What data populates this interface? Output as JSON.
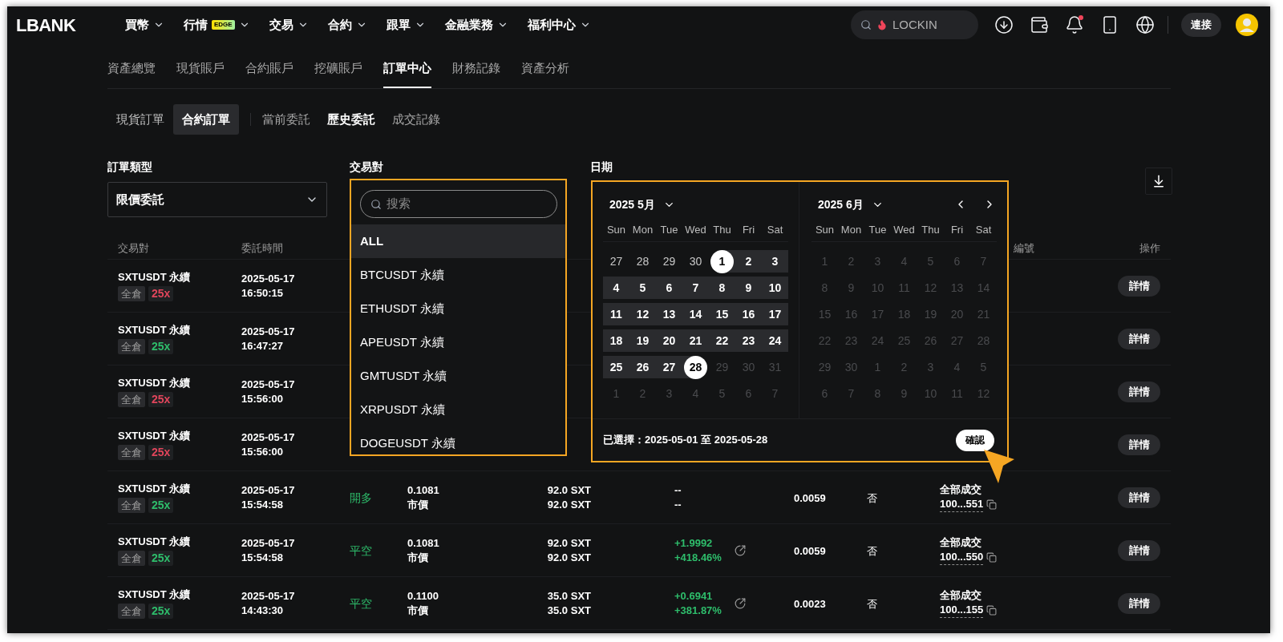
{
  "logo": "LBANK",
  "nav": [
    {
      "label": "買幣"
    },
    {
      "label": "行情",
      "badge": "EDGE"
    },
    {
      "label": "交易"
    },
    {
      "label": "合約"
    },
    {
      "label": "跟單"
    },
    {
      "label": "金融業務"
    },
    {
      "label": "福利中心"
    }
  ],
  "search": {
    "placeholder": "LOCKIN"
  },
  "connect_button": "連接",
  "account_tabs": [
    {
      "label": "資產總覽",
      "selected": false
    },
    {
      "label": "現貨賬戶",
      "selected": false
    },
    {
      "label": "合約賬戶",
      "selected": false
    },
    {
      "label": "挖礦賬戶",
      "selected": false
    },
    {
      "label": "訂單中心",
      "selected": true
    },
    {
      "label": "財務記錄",
      "selected": false
    },
    {
      "label": "資產分析",
      "selected": false
    }
  ],
  "market_tabs": [
    {
      "label": "現貨訂單",
      "selected": false
    },
    {
      "label": "合約訂單",
      "selected": true
    }
  ],
  "order_tabs": [
    {
      "label": "當前委託",
      "selected": false
    },
    {
      "label": "歷史委託",
      "selected": true
    },
    {
      "label": "成交記錄",
      "selected": false
    }
  ],
  "filters": {
    "order_type": {
      "label": "訂單類型",
      "value": "限價委託"
    },
    "pair": {
      "label": "交易對"
    },
    "date": {
      "label": "日期"
    }
  },
  "pair_dropdown": {
    "placeholder": "搜索",
    "options": [
      {
        "label": "ALL",
        "selected": true
      },
      {
        "label": "BTCUSDT 永續",
        "selected": false
      },
      {
        "label": "ETHUSDT 永續",
        "selected": false
      },
      {
        "label": "APEUSDT 永續",
        "selected": false
      },
      {
        "label": "GMTUSDT 永續",
        "selected": false
      },
      {
        "label": "XRPUSDT 永續",
        "selected": false
      },
      {
        "label": "DOGEUSDT 永續",
        "selected": false
      }
    ]
  },
  "calendar": {
    "months": [
      {
        "title": "2025 5月",
        "weekdays": [
          "Sun",
          "Mon",
          "Tue",
          "Wed",
          "Thu",
          "Fri",
          "Sat"
        ],
        "days": [
          {
            "day": "27",
            "kind": "normal"
          },
          {
            "day": "28",
            "kind": "normal"
          },
          {
            "day": "29",
            "kind": "normal"
          },
          {
            "day": "30",
            "kind": "normal"
          },
          {
            "day": "1",
            "kind": "range_start"
          },
          {
            "day": "2",
            "kind": "in_range"
          },
          {
            "day": "3",
            "kind": "in_range"
          },
          {
            "day": "4",
            "kind": "in_range"
          },
          {
            "day": "5",
            "kind": "in_range"
          },
          {
            "day": "6",
            "kind": "in_range"
          },
          {
            "day": "7",
            "kind": "in_range"
          },
          {
            "day": "8",
            "kind": "in_range"
          },
          {
            "day": "9",
            "kind": "in_range"
          },
          {
            "day": "10",
            "kind": "in_range"
          },
          {
            "day": "11",
            "kind": "in_range"
          },
          {
            "day": "12",
            "kind": "in_range"
          },
          {
            "day": "13",
            "kind": "in_range"
          },
          {
            "day": "14",
            "kind": "in_range"
          },
          {
            "day": "15",
            "kind": "in_range"
          },
          {
            "day": "16",
            "kind": "in_range"
          },
          {
            "day": "17",
            "kind": "in_range"
          },
          {
            "day": "18",
            "kind": "in_range"
          },
          {
            "day": "19",
            "kind": "in_range"
          },
          {
            "day": "20",
            "kind": "in_range"
          },
          {
            "day": "21",
            "kind": "in_range"
          },
          {
            "day": "22",
            "kind": "in_range"
          },
          {
            "day": "23",
            "kind": "in_range"
          },
          {
            "day": "24",
            "kind": "in_range"
          },
          {
            "day": "25",
            "kind": "in_range"
          },
          {
            "day": "26",
            "kind": "in_range"
          },
          {
            "day": "27",
            "kind": "in_range"
          },
          {
            "day": "28",
            "kind": "range_end"
          },
          {
            "day": "29",
            "kind": "disabled"
          },
          {
            "day": "30",
            "kind": "disabled"
          },
          {
            "day": "31",
            "kind": "disabled"
          },
          {
            "day": "1",
            "kind": "disabled"
          },
          {
            "day": "2",
            "kind": "disabled"
          },
          {
            "day": "3",
            "kind": "disabled"
          },
          {
            "day": "4",
            "kind": "disabled"
          },
          {
            "day": "5",
            "kind": "disabled"
          },
          {
            "day": "6",
            "kind": "disabled"
          },
          {
            "day": "7",
            "kind": "disabled"
          }
        ]
      },
      {
        "title": "2025 6月",
        "weekdays": [
          "Sun",
          "Mon",
          "Tue",
          "Wed",
          "Thu",
          "Fri",
          "Sat"
        ],
        "days": [
          {
            "day": "1",
            "kind": "disabled"
          },
          {
            "day": "2",
            "kind": "disabled"
          },
          {
            "day": "3",
            "kind": "disabled"
          },
          {
            "day": "4",
            "kind": "disabled"
          },
          {
            "day": "5",
            "kind": "disabled"
          },
          {
            "day": "6",
            "kind": "disabled"
          },
          {
            "day": "7",
            "kind": "disabled"
          },
          {
            "day": "8",
            "kind": "disabled"
          },
          {
            "day": "9",
            "kind": "disabled"
          },
          {
            "day": "10",
            "kind": "disabled"
          },
          {
            "day": "11",
            "kind": "disabled"
          },
          {
            "day": "12",
            "kind": "disabled"
          },
          {
            "day": "13",
            "kind": "disabled"
          },
          {
            "day": "14",
            "kind": "disabled"
          },
          {
            "day": "15",
            "kind": "disabled"
          },
          {
            "day": "16",
            "kind": "disabled"
          },
          {
            "day": "17",
            "kind": "disabled"
          },
          {
            "day": "18",
            "kind": "disabled"
          },
          {
            "day": "19",
            "kind": "disabled"
          },
          {
            "day": "20",
            "kind": "disabled"
          },
          {
            "day": "21",
            "kind": "disabled"
          },
          {
            "day": "22",
            "kind": "disabled"
          },
          {
            "day": "23",
            "kind": "disabled"
          },
          {
            "day": "24",
            "kind": "disabled"
          },
          {
            "day": "25",
            "kind": "disabled"
          },
          {
            "day": "26",
            "kind": "disabled"
          },
          {
            "day": "27",
            "kind": "disabled"
          },
          {
            "day": "28",
            "kind": "disabled"
          },
          {
            "day": "29",
            "kind": "disabled"
          },
          {
            "day": "30",
            "kind": "disabled"
          },
          {
            "day": "1",
            "kind": "disabled"
          },
          {
            "day": "2",
            "kind": "disabled"
          },
          {
            "day": "3",
            "kind": "disabled"
          },
          {
            "day": "4",
            "kind": "disabled"
          },
          {
            "day": "5",
            "kind": "disabled"
          },
          {
            "day": "6",
            "kind": "disabled"
          },
          {
            "day": "7",
            "kind": "disabled"
          },
          {
            "day": "8",
            "kind": "disabled"
          },
          {
            "day": "9",
            "kind": "disabled"
          },
          {
            "day": "10",
            "kind": "disabled"
          },
          {
            "day": "11",
            "kind": "disabled"
          },
          {
            "day": "12",
            "kind": "disabled"
          }
        ]
      }
    ],
    "summary": "已選擇：2025-05-01 至 2025-05-28",
    "confirm": "確認"
  },
  "table": {
    "header": {
      "pair": "交易對",
      "time": "委託時間",
      "column_10": "編號",
      "action": "操作"
    },
    "rows": [
      {
        "pair": "SXTUSDT 永續",
        "margin": "全倉",
        "leverage": {
          "text": "25x",
          "color": "#e0455b"
        },
        "time": [
          "2025-05-17",
          "16:50:15"
        ],
        "action": "詳情"
      },
      {
        "pair": "SXTUSDT 永續",
        "margin": "全倉",
        "leverage": {
          "text": "25x",
          "color": "#2ebd6b"
        },
        "time": [
          "2025-05-17",
          "16:47:27"
        ],
        "action": "詳情"
      },
      {
        "pair": "SXTUSDT 永續",
        "margin": "全倉",
        "leverage": {
          "text": "25x",
          "color": "#e0455b"
        },
        "time": [
          "2025-05-17",
          "15:56:00"
        ],
        "action": "詳情"
      },
      {
        "pair": "SXTUSDT 永續",
        "margin": "全倉",
        "leverage": {
          "text": "25x",
          "color": "#e0455b"
        },
        "time": [
          "2025-05-17",
          "15:56:00"
        ],
        "action": "詳情"
      },
      {
        "pair": "SXTUSDT 永續",
        "margin": "全倉",
        "leverage": {
          "text": "25x",
          "color": "#2ebd6b"
        },
        "time": [
          "2025-05-17",
          "15:54:58"
        ],
        "side": "開多",
        "price": [
          "0.1081",
          "市價"
        ],
        "amount": [
          "92.0 SXT",
          "92.0 SXT"
        ],
        "pnl": {
          "values": [
            "--",
            "--"
          ],
          "color": "#ffffff",
          "share": false
        },
        "fee": "0.0059",
        "reduce_only": "否",
        "status": "全部成交",
        "order_id": "100...551",
        "action": "詳情"
      },
      {
        "pair": "SXTUSDT 永續",
        "margin": "全倉",
        "leverage": {
          "text": "25x",
          "color": "#2ebd6b"
        },
        "time": [
          "2025-05-17",
          "15:54:58"
        ],
        "side": "平空",
        "price": [
          "0.1081",
          "市價"
        ],
        "amount": [
          "92.0 SXT",
          "92.0 SXT"
        ],
        "pnl": {
          "values": [
            "+1.9992",
            "+418.46%"
          ],
          "color": "#2ebd6b",
          "share": true
        },
        "fee": "0.0059",
        "reduce_only": "否",
        "status": "全部成交",
        "order_id": "100...550",
        "action": "詳情"
      },
      {
        "pair": "SXTUSDT 永續",
        "margin": "全倉",
        "leverage": {
          "text": "25x",
          "color": "#2ebd6b"
        },
        "time": [
          "2025-05-17",
          "14:43:30"
        ],
        "side": "平空",
        "price": [
          "0.1100",
          "市價"
        ],
        "amount": [
          "35.0 SXT",
          "35.0 SXT"
        ],
        "pnl": {
          "values": [
            "+0.6941",
            "+381.87%"
          ],
          "color": "#2ebd6b",
          "share": true
        },
        "fee": "0.0023",
        "reduce_only": "否",
        "status": "全部成交",
        "order_id": "100...155",
        "action": "詳情"
      }
    ]
  }
}
